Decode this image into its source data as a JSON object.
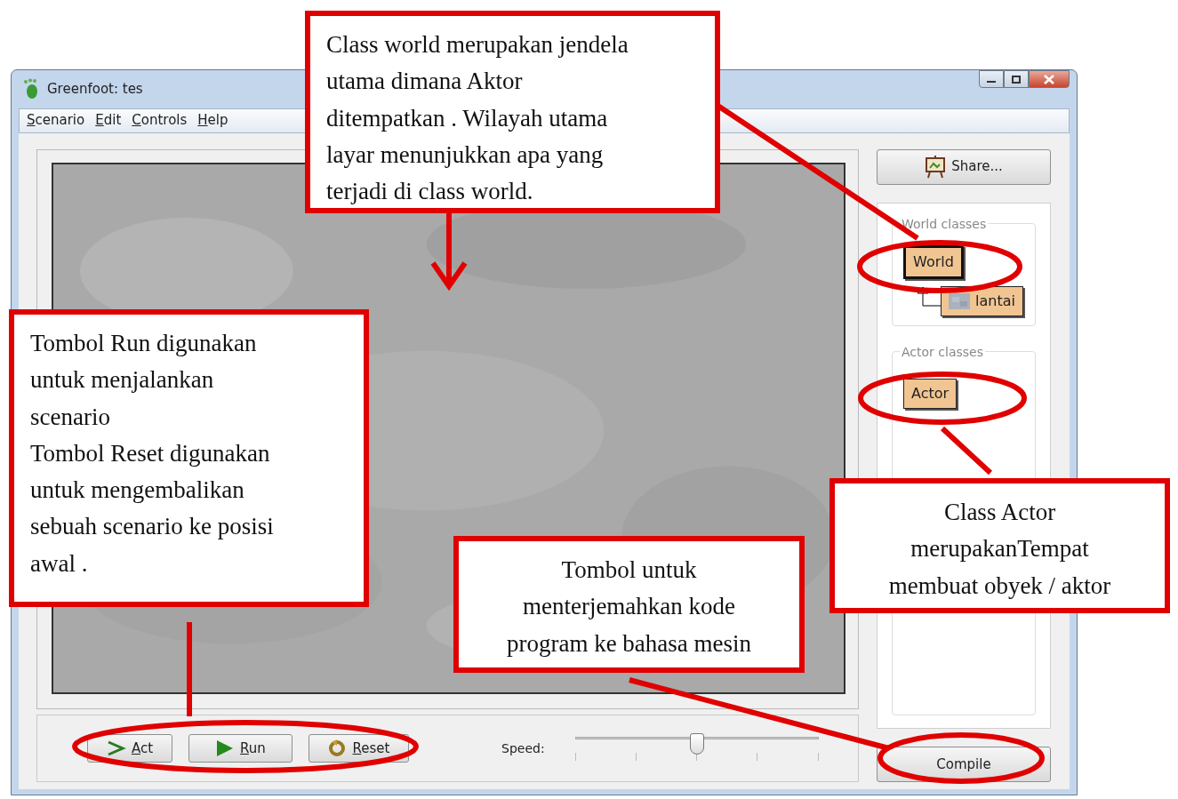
{
  "window": {
    "title": "Greenfoot: tes"
  },
  "menu": [
    {
      "label": "Scenario"
    },
    {
      "label": "Edit"
    },
    {
      "label": "Controls"
    },
    {
      "label": "Help"
    }
  ],
  "share_button": {
    "label": "Share..."
  },
  "world_classes": {
    "title": "World classes",
    "classes": [
      {
        "name": "World",
        "selected": true,
        "children": [
          {
            "name": "lantai",
            "selected": false
          }
        ]
      }
    ]
  },
  "actor_classes": {
    "title": "Actor classes",
    "classes": [
      {
        "name": "Actor",
        "selected": false
      }
    ]
  },
  "controls": {
    "buttons": [
      {
        "kind": "act",
        "label": "Act"
      },
      {
        "kind": "run",
        "label": "Run"
      },
      {
        "kind": "reset",
        "label": "Reset"
      }
    ],
    "speed": {
      "label": "Speed:",
      "level": 0.5
    }
  },
  "compile_button": {
    "label": "Compile"
  },
  "annotations": [
    {
      "kind": "paragraph",
      "text": "Class world merupakan jendela\nutama dimana Aktor\nditempatkan . Wilayah utama\nlayar  menunjukkan apa yang\nterjadi di  class world."
    },
    {
      "kind": "paragraph",
      "text": "Tombol Run digunakan\nuntuk menjalankan\nscenario\nTombol Reset digunakan\nuntuk mengembalikan\nsebuah scenario ke posisi\nawal ."
    },
    {
      "kind": "caption",
      "text": "Tombol untuk\nmenterjemahkan  kode\nprogram ke bahasa mesin"
    },
    {
      "kind": "caption",
      "text": "Class Actor\nmerupakanTempat\nmembuat obyek / aktor"
    }
  ]
}
